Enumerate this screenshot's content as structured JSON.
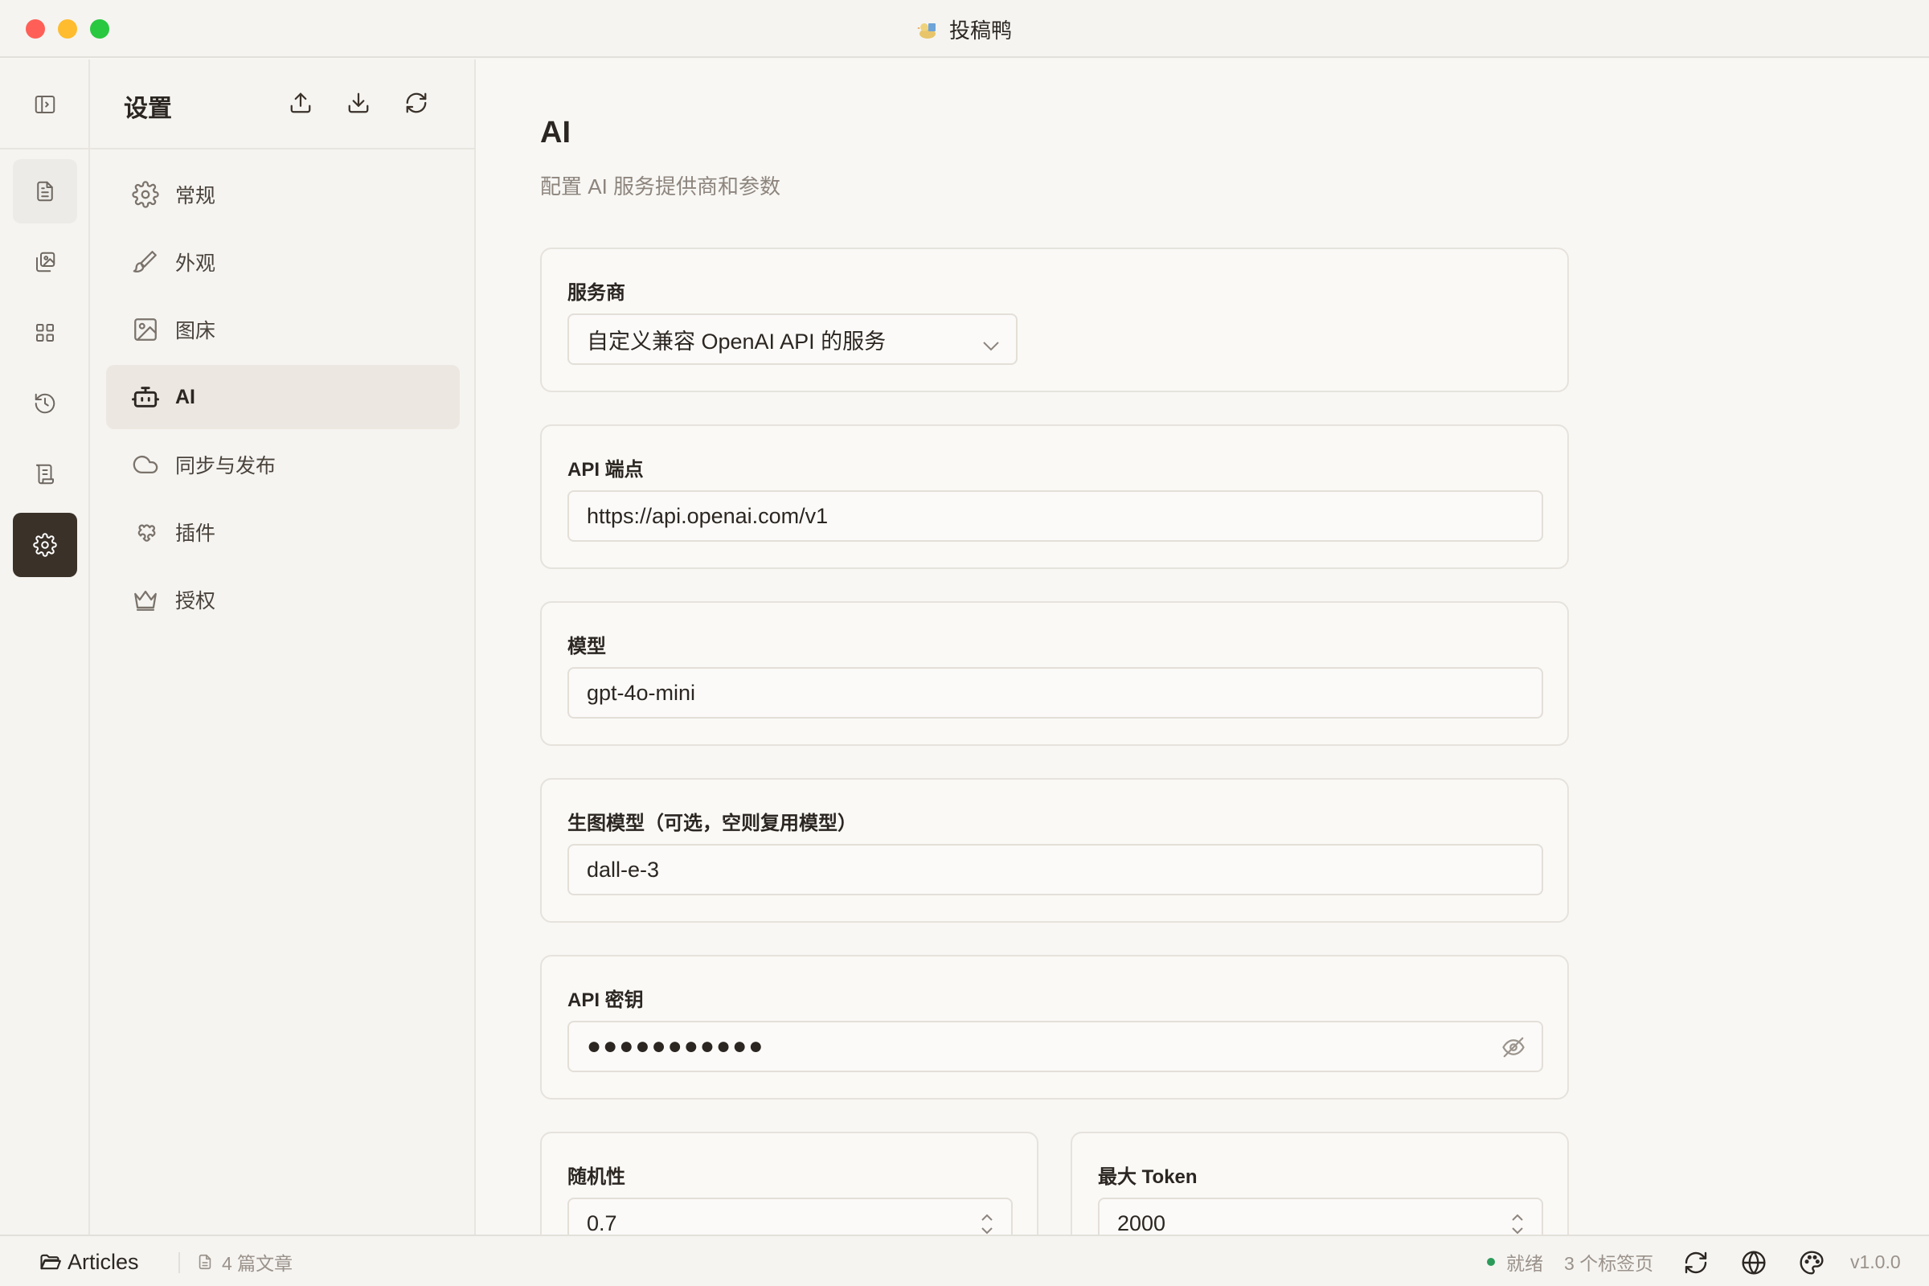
{
  "window": {
    "title": "投稿鸭"
  },
  "rail": {
    "items": [
      {
        "name": "articles",
        "icon": "file-text-icon"
      },
      {
        "name": "images",
        "icon": "image-copy-icon"
      },
      {
        "name": "apps",
        "icon": "grid-icon"
      },
      {
        "name": "history",
        "icon": "history-icon"
      },
      {
        "name": "scroll",
        "icon": "scroll-icon"
      },
      {
        "name": "settings",
        "icon": "gear-icon",
        "active": true
      }
    ]
  },
  "sidebar": {
    "title": "设置",
    "actions": [
      "upload-icon",
      "download-icon",
      "refresh-icon"
    ],
    "items": [
      {
        "label": "常规",
        "icon": "gear-icon"
      },
      {
        "label": "外观",
        "icon": "brush-icon"
      },
      {
        "label": "图床",
        "icon": "image-icon"
      },
      {
        "label": "AI",
        "icon": "bot-icon",
        "active": true
      },
      {
        "label": "同步与发布",
        "icon": "cloud-icon"
      },
      {
        "label": "插件",
        "icon": "puzzle-icon"
      },
      {
        "label": "授权",
        "icon": "crown-icon"
      }
    ]
  },
  "main": {
    "title": "AI",
    "subtitle": "配置 AI 服务提供商和参数",
    "provider": {
      "label": "服务商",
      "value": "自定义兼容 OpenAI API 的服务"
    },
    "endpoint": {
      "label": "API 端点",
      "value": "https://api.openai.com/v1"
    },
    "model": {
      "label": "模型",
      "value": "gpt-4o-mini"
    },
    "image_model": {
      "label": "生图模型（可选，空则复用模型）",
      "value": "dall-e-3"
    },
    "api_key": {
      "label": "API 密钥",
      "value": "●●●●●●●●●●●"
    },
    "temperature": {
      "label": "随机性",
      "value": "0.7"
    },
    "max_tokens": {
      "label": "最大 Token",
      "value": "2000"
    }
  },
  "statusbar": {
    "folder": "Articles",
    "article_count": "4 篇文章",
    "status": "就绪",
    "status_color": "#2c9b5a",
    "tabs": "3 个标签页",
    "version": "v1.0.0"
  },
  "colors": {
    "accent_dark": "#3a3129",
    "active_nav_bg": "#ece7e0"
  }
}
